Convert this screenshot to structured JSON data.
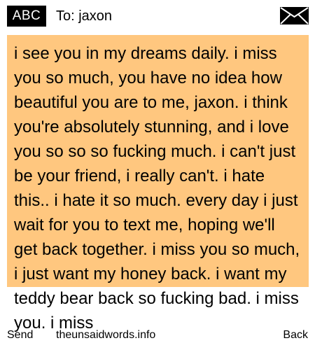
{
  "header": {
    "mode_label": "ABC",
    "recipient_text": "To: jaxon",
    "icon": "envelope-icon"
  },
  "message": {
    "text": "i see you in my dreams daily. i miss you so much, you have no idea how beautiful you are to me, jaxon. i think you're absolutely stunning, and i love you so so so fucking much. i can't just be your friend, i really can't. i hate this.. i hate it so much. every day i just wait for you to text me, hoping we'll get back together. i miss you so much, i just want my honey back. i want my teddy bear back so fucking bad. i miss you. i miss"
  },
  "softkeys": {
    "left": "Send",
    "center": "theunsaidwords.info",
    "right": "Back"
  },
  "colors": {
    "message_background": "#ffc77f",
    "badge_background": "#000000"
  }
}
